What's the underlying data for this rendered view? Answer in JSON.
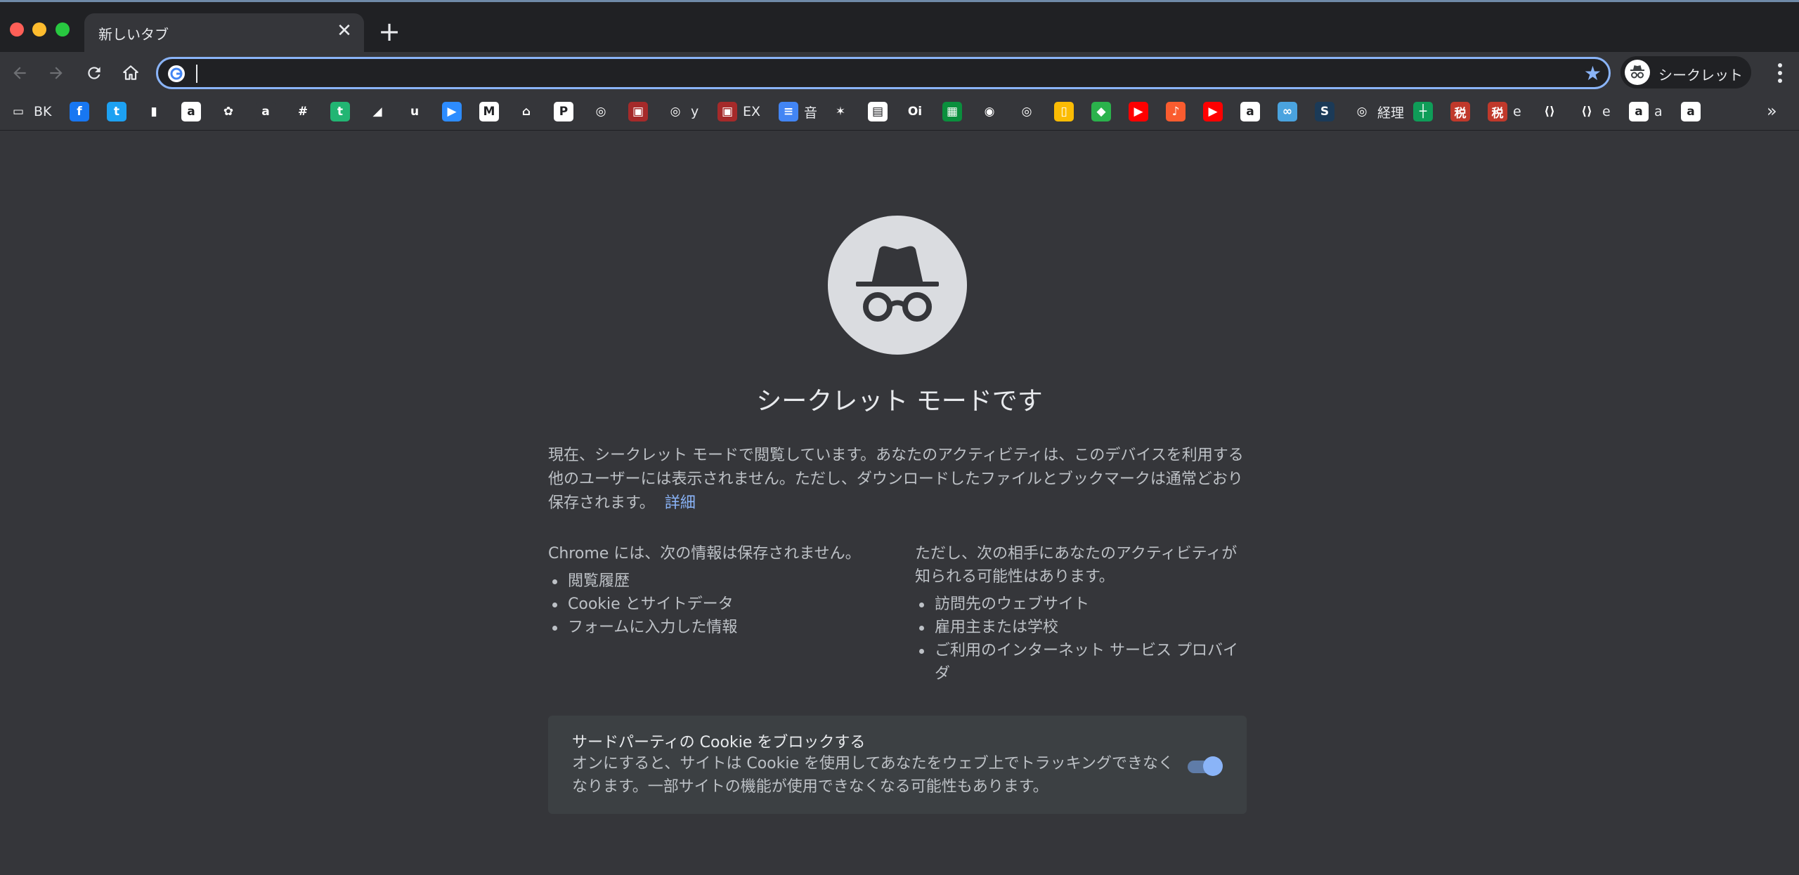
{
  "window": {
    "tab_title": "新しいタブ",
    "tab_close_glyph": "✕",
    "new_tab_glyph": "+"
  },
  "toolbar": {
    "back_icon": "arrow-left-icon",
    "forward_icon": "arrow-right-icon",
    "reload_icon": "reload-icon",
    "home_icon": "home-icon",
    "omnibox_value": "",
    "bookmark_star_glyph": "★",
    "profile_label": "シークレット"
  },
  "bookmarks": {
    "items": [
      {
        "icon": "folder-icon",
        "label": "BK",
        "bg": "#35363a",
        "glyph": "▭"
      },
      {
        "icon": "facebook-icon",
        "label": "",
        "bg": "#1877f2",
        "glyph": "f"
      },
      {
        "icon": "twitter-icon",
        "label": "",
        "bg": "#1da1f2",
        "glyph": "t"
      },
      {
        "icon": "analytics-icon",
        "label": "",
        "bg": "#35363a",
        "glyph": "▮"
      },
      {
        "icon": "amazon-icon",
        "label": "",
        "bg": "#ffffff",
        "glyph": "a"
      },
      {
        "icon": "photos-icon",
        "label": "",
        "bg": "#35363a",
        "glyph": "✿"
      },
      {
        "icon": "amazon-icon",
        "label": "",
        "bg": "#35363a",
        "glyph": "a"
      },
      {
        "icon": "slack-icon",
        "label": "",
        "bg": "#35363a",
        "glyph": "#"
      },
      {
        "icon": "t-circle-icon",
        "label": "",
        "bg": "#22b573",
        "glyph": "t"
      },
      {
        "icon": "google-ads-icon",
        "label": "",
        "bg": "#35363a",
        "glyph": "◢"
      },
      {
        "icon": "u-icon",
        "label": "",
        "bg": "#35363a",
        "glyph": "u"
      },
      {
        "icon": "zoom-icon",
        "label": "",
        "bg": "#2d8cff",
        "glyph": "▶"
      },
      {
        "icon": "gmail-icon",
        "label": "",
        "bg": "#ffffff",
        "glyph": "M"
      },
      {
        "icon": "store-icon",
        "label": "",
        "bg": "#35363a",
        "glyph": "⌂"
      },
      {
        "icon": "pin-icon",
        "label": "",
        "bg": "#ffffff",
        "glyph": "P"
      },
      {
        "icon": "globe-icon",
        "label": "",
        "bg": "#35363a",
        "glyph": "◎"
      },
      {
        "icon": "red-square-icon",
        "label": "",
        "bg": "#a52a2a",
        "glyph": "▣"
      },
      {
        "icon": "globe-icon",
        "label": "y",
        "bg": "#35363a",
        "glyph": "◎"
      },
      {
        "icon": "red-square-icon",
        "label": "EX",
        "bg": "#a52a2a",
        "glyph": "▣"
      },
      {
        "icon": "docs-icon",
        "label": "音",
        "bg": "#4285f4",
        "glyph": "≡"
      },
      {
        "icon": "colorful-icon",
        "label": "",
        "bg": "#35363a",
        "glyph": "✶"
      },
      {
        "icon": "map-icon",
        "label": "",
        "bg": "#ffffff",
        "glyph": "▤"
      },
      {
        "icon": "oi-icon",
        "label": "",
        "bg": "#35363a",
        "glyph": "Oi"
      },
      {
        "icon": "green-square-icon",
        "label": "",
        "bg": "#0a8f3d",
        "glyph": "▦"
      },
      {
        "icon": "circle-icon",
        "label": "",
        "bg": "#35363a",
        "glyph": "◉"
      },
      {
        "icon": "globe-icon",
        "label": "",
        "bg": "#35363a",
        "glyph": "◎"
      },
      {
        "icon": "keep-icon",
        "label": "",
        "bg": "#fbbc04",
        "glyph": "▯"
      },
      {
        "icon": "feedly-icon",
        "label": "",
        "bg": "#2bb24c",
        "glyph": "◆"
      },
      {
        "icon": "youtube-music-icon",
        "label": "",
        "bg": "#ff0000",
        "glyph": "▶"
      },
      {
        "icon": "music-icon",
        "label": "",
        "bg": "#fa5c2f",
        "glyph": "♪"
      },
      {
        "icon": "youtube-icon",
        "label": "",
        "bg": "#ff0000",
        "glyph": "▶"
      },
      {
        "icon": "amazon-icon",
        "label": "",
        "bg": "#ffffff",
        "glyph": "a"
      },
      {
        "icon": "binoculars-icon",
        "label": "",
        "bg": "#4aa3df",
        "glyph": "∞"
      },
      {
        "icon": "s-icon",
        "label": "",
        "bg": "#1b3a57",
        "glyph": "S"
      },
      {
        "icon": "globe-icon",
        "label": "経理",
        "bg": "#35363a",
        "glyph": "◎"
      },
      {
        "icon": "sheets-icon",
        "label": "",
        "bg": "#0f9d58",
        "glyph": "┼"
      },
      {
        "icon": "tax-icon",
        "label": "",
        "bg": "#c0392b",
        "glyph": "税"
      },
      {
        "icon": "tax-icon",
        "label": "e",
        "bg": "#c0392b",
        "glyph": "税"
      },
      {
        "icon": "bracket-icon",
        "label": "",
        "bg": "#35363a",
        "glyph": "⟨⟩"
      },
      {
        "icon": "bracket-icon",
        "label": "e",
        "bg": "#35363a",
        "glyph": "⟨⟩"
      },
      {
        "icon": "amazon-icon",
        "label": "a",
        "bg": "#ffffff",
        "glyph": "a"
      },
      {
        "icon": "amazon-icon",
        "label": "",
        "bg": "#ffffff",
        "glyph": "a"
      }
    ],
    "overflow_glyph": "»"
  },
  "incognito": {
    "heading": "シークレット モードです",
    "intro_text": "現在、シークレット モードで閲覧しています。あなたのアクティビティは、このデバイスを利用する他のユーザーには表示されません。ただし、ダウンロードしたファイルとブックマークは通常どおり保存されます。",
    "learn_more": "詳細",
    "not_saved_heading": "Chrome には、次の情報は保存されません。",
    "not_saved_items": [
      "閲覧履歴",
      "Cookie とサイトデータ",
      "フォームに入力した情報"
    ],
    "visible_heading": "ただし、次の相手にあなたのアクティビティが知られる可能性はあります。",
    "visible_items": [
      "訪問先のウェブサイト",
      "雇用主または学校",
      "ご利用のインターネット サービス プロバイダ"
    ],
    "cookie_title": "サードパーティの Cookie をブロックする",
    "cookie_desc": "オンにすると、サイトは Cookie を使用してあなたをウェブ上でトラッキングできなくなります。一部サイトの機能が使用できなくなる可能性もあります。",
    "cookie_toggle_on": true
  },
  "colors": {
    "accent": "#8ab4f8",
    "background": "#35363a",
    "frame": "#202124"
  }
}
